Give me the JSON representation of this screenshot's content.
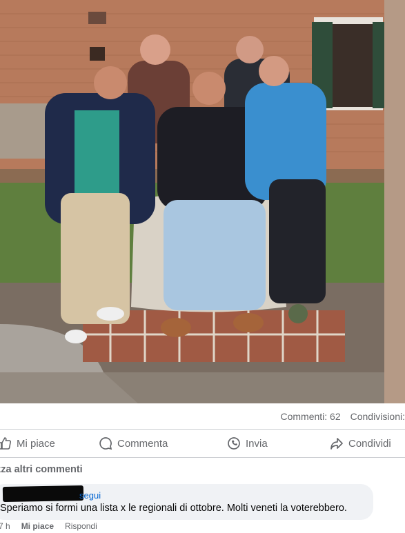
{
  "post": {
    "photo_alt_icon": "group-photo-image",
    "stats": {
      "comments": "Commenti: 62",
      "shares": "Condivisioni:"
    },
    "actions": {
      "like": "Mi piace",
      "comment": "Commenta",
      "send": "Invia",
      "share": "Condividi"
    }
  },
  "comments_section": {
    "view_more": "zza altri commenti",
    "comment": {
      "follow_label": "segui",
      "text": "Speriamo si formi una lista x le regionali di ottobre. Molti veneti la voterebbero.",
      "time": "7 h",
      "like_label": "Mi piace",
      "reply_label": "Rispondi"
    }
  },
  "colors": {
    "link": "#0064d1",
    "muted_text": "#65676b",
    "bubble": "#f0f2f5"
  }
}
